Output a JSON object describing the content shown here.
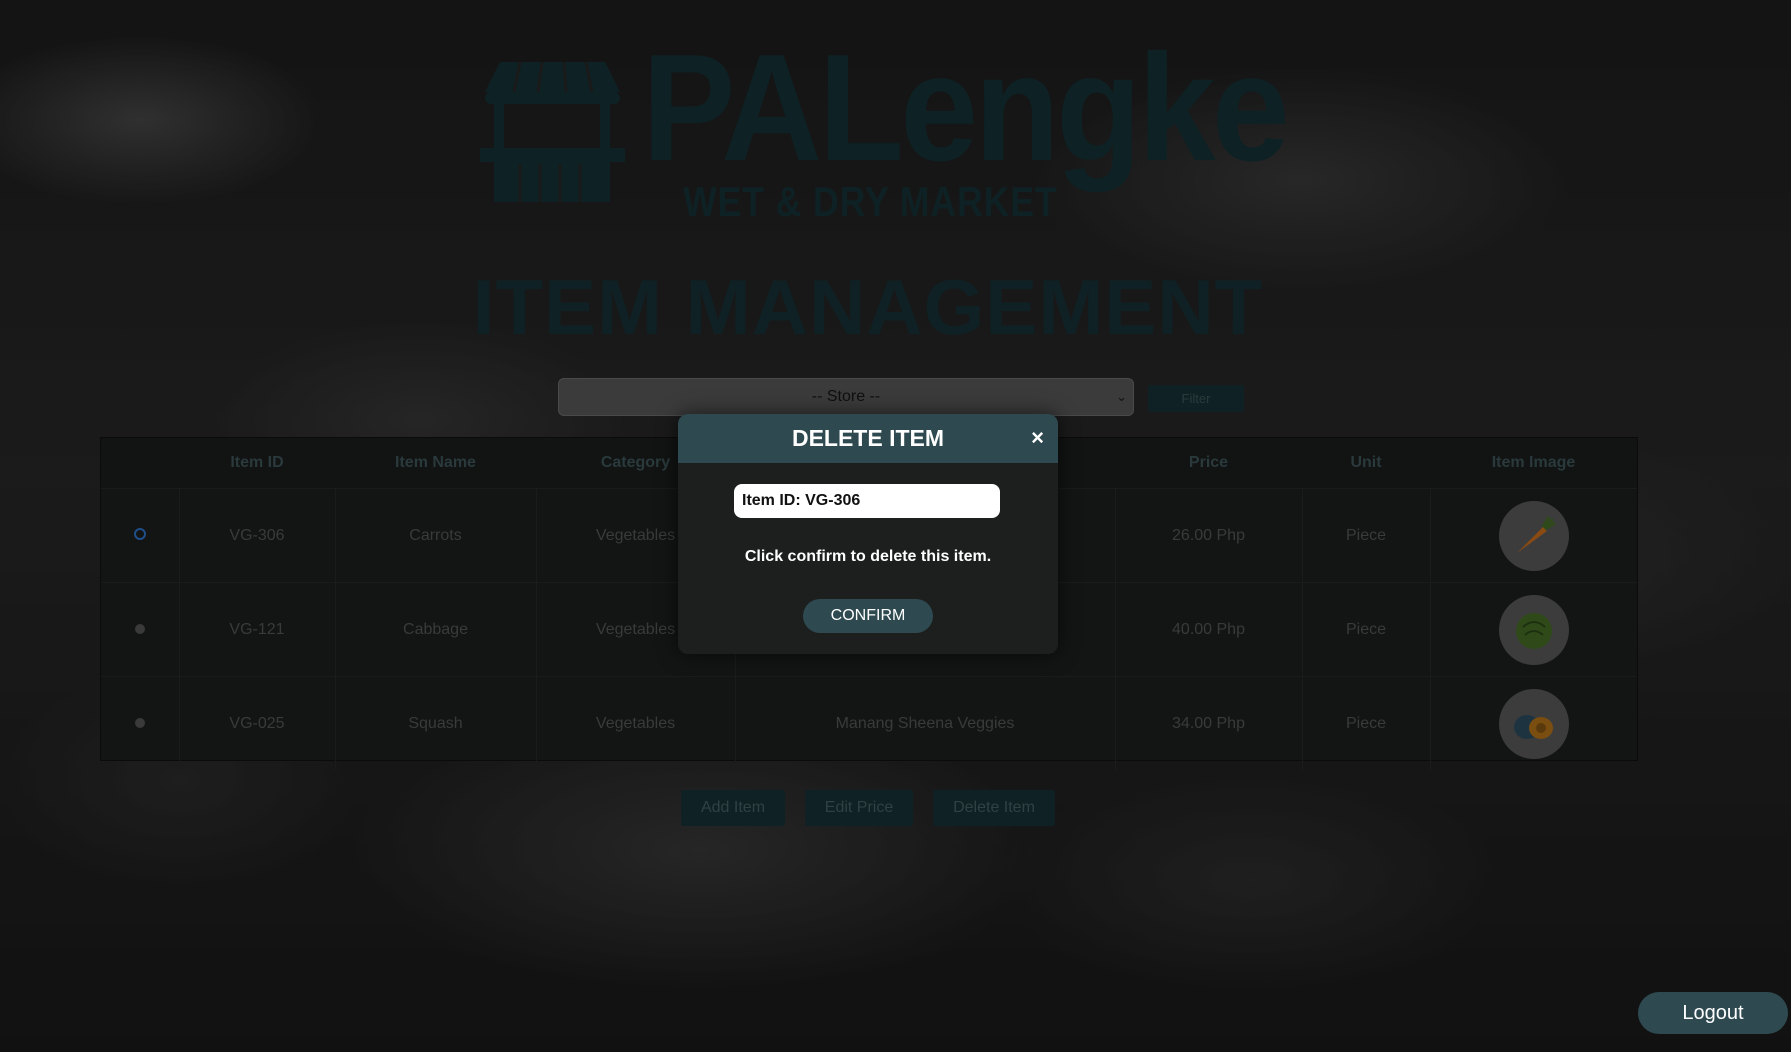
{
  "brand": {
    "name": "PALengke",
    "tagline": "WET & DRY MARKET"
  },
  "page_title": "ITEM MANAGEMENT",
  "filter": {
    "store_placeholder": "-- Store --",
    "filter_label": "Filter"
  },
  "table": {
    "headers": [
      "",
      "Item ID",
      "Item Name",
      "Category",
      "",
      "Price",
      "Unit",
      "Item Image"
    ],
    "rows": [
      {
        "id": "VG-306",
        "name": "Carrots",
        "category": "Vegetables",
        "store": "",
        "price": "26.00 Php",
        "unit": "Piece",
        "image": "carrot-icon",
        "selected": true
      },
      {
        "id": "VG-121",
        "name": "Cabbage",
        "category": "Vegetables",
        "store": "",
        "price": "40.00 Php",
        "unit": "Piece",
        "image": "cabbage-icon",
        "selected": false
      },
      {
        "id": "VG-025",
        "name": "Squash",
        "category": "Vegetables",
        "store": "Manang Sheena Veggies",
        "price": "34.00 Php",
        "unit": "Piece",
        "image": "squash-icon",
        "selected": false
      }
    ]
  },
  "actions": {
    "add_item": "Add Item",
    "edit_price": "Edit Price",
    "delete_item": "Delete Item"
  },
  "modal": {
    "title": "DELETE ITEM",
    "close_symbol": "×",
    "input_value": "Item ID: VG-306",
    "message": "Click confirm to delete this item.",
    "confirm_label": "CONFIRM"
  },
  "logout_label": "Logout",
  "colors": {
    "accent": "#2e4a50",
    "dark_teal": "#0f2124"
  }
}
